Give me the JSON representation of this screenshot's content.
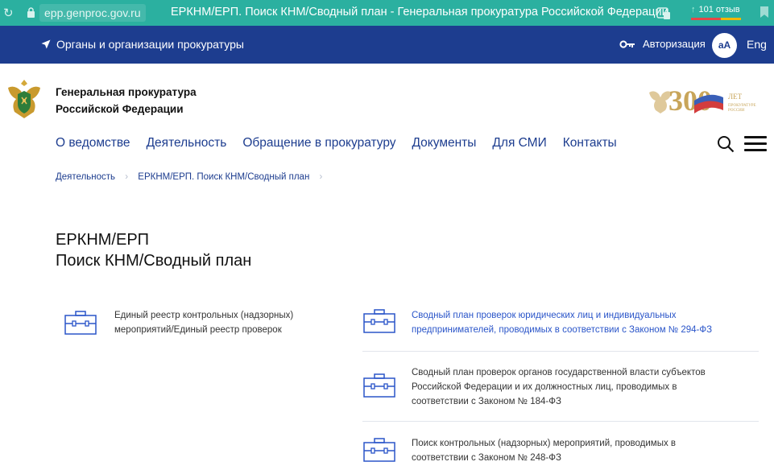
{
  "browser": {
    "url": "epp.genproc.gov.ru",
    "tab_title": "ЕРКНМ/ЕРП. Поиск КНМ/Сводный план - Генеральная прокуратура Российской Федерации",
    "reviews": "101 отзыв"
  },
  "topbar": {
    "org_link": "Органы и организации прокуратуры",
    "auth_label": "Авторизация",
    "font_toggle": "аА",
    "lang": "Eng"
  },
  "header": {
    "org_name_line1": "Генеральная прокуратура",
    "org_name_line2": "Российской Федерации",
    "jubilee_number": "300",
    "jubilee_small_1": "ЛЕТ",
    "jubilee_small_2": "ПРОКУРАТУРЕ",
    "jubilee_small_3": "РОССИИ"
  },
  "nav": {
    "items": [
      "О ведомстве",
      "Деятельность",
      "Обращение в прокуратуру",
      "Документы",
      "Для СМИ",
      "Контакты"
    ]
  },
  "breadcrumb": {
    "item1": "Деятельность",
    "item2": "ЕРКНМ/ЕРП. Поиск КНМ/Сводный план",
    "sep": "›"
  },
  "page": {
    "title_line1": "ЕРКНМ/ЕРП",
    "title_line2": "Поиск КНМ/Сводный план"
  },
  "cards": {
    "left": {
      "line1": "Единый реестр контрольных (надзорных)",
      "line2": "мероприятий/Единый реестр проверок"
    },
    "right": [
      {
        "line1": "Сводный план проверок юридических лиц и индивидуальных",
        "line2": "предпринимателей, проводимых в соответствии с Законом № 294-ФЗ"
      },
      {
        "line1": "Сводный план проверок органов государственной власти субъектов",
        "line2": "Российской Федерации и их должностных лиц, проводимых в",
        "line3": "соответствии с Законом № 184-ФЗ"
      },
      {
        "line1": "Поиск контрольных (надзорных) мероприятий, проводимых в",
        "line2": "соответствии с Законом № 248-ФЗ"
      }
    ]
  },
  "colors": {
    "topbar": "#1d3d8f",
    "browser": "#2bb0a0",
    "link": "#2a55c9",
    "accent_gold": "#c8a55a"
  }
}
